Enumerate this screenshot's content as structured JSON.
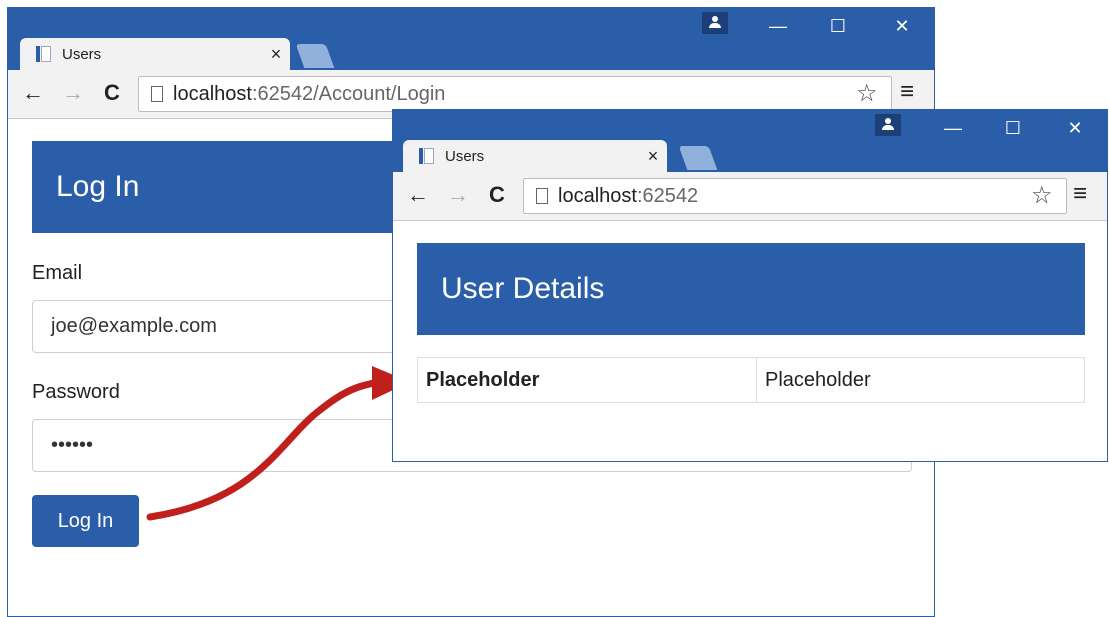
{
  "back_window": {
    "tab_title": "Users",
    "tab_close": "×",
    "controls": {
      "minimize": "—",
      "maximize": "☐",
      "close": "✕"
    },
    "nav": {
      "back": "←",
      "forward": "→",
      "reload": "C"
    },
    "url_host": "localhost",
    "url_rest": ":62542/Account/Login",
    "star": "☆",
    "menu": "≡",
    "heading": "Log In",
    "email_label": "Email",
    "email_value": "joe@example.com",
    "password_label": "Password",
    "password_value": "••••••",
    "login_button": "Log In"
  },
  "front_window": {
    "tab_title": "Users",
    "tab_close": "×",
    "controls": {
      "minimize": "—",
      "maximize": "☐",
      "close": "✕"
    },
    "nav": {
      "back": "←",
      "forward": "→",
      "reload": "C"
    },
    "url_host": "localhost",
    "url_rest": ":62542",
    "star": "☆",
    "menu": "≡",
    "heading": "User Details",
    "table": [
      {
        "key": "Placeholder",
        "value": "Placeholder"
      }
    ]
  },
  "colors": {
    "brand": "#2b5ea8",
    "arrow": "#c0201c"
  }
}
